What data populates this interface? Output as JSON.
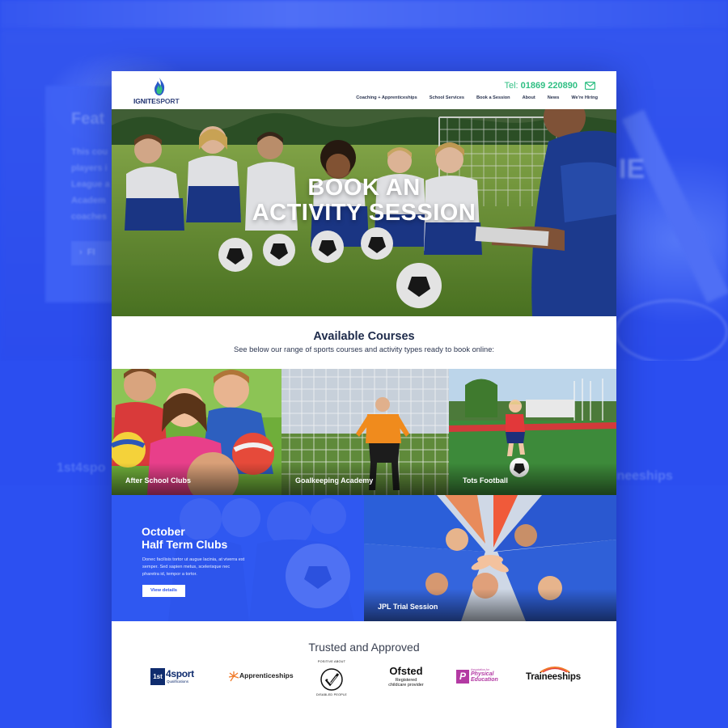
{
  "background": {
    "left_heading": "Feat",
    "left_lines": [
      "This cou",
      "players i",
      "League a",
      "Academ",
      "coaches"
    ],
    "left_button": "FI",
    "side_word": "IE",
    "logo_left": "1st4spo",
    "logo_right": "ineeships"
  },
  "header": {
    "logo_brand": "IGNITE",
    "logo_brand_2": "SPORT",
    "tel_label": "Tel:",
    "tel_number": "01869 220890",
    "nav": [
      "Coaching + Apprenticeships",
      "School Services",
      "Book a Session",
      "About",
      "News",
      "We're Hiring"
    ]
  },
  "hero": {
    "title_line1": "BOOK AN",
    "title_line2": "ACTIVITY SESSION"
  },
  "courses": {
    "heading": "Available Courses",
    "subheading": "See below our range of sports courses and activity types ready to book online:",
    "tiles": [
      "After School Clubs",
      "Goalkeeping Academy",
      "Tots Football",
      "JPL Trial Session"
    ]
  },
  "promo": {
    "title_line1": "October",
    "title_line2": "Half Term Clubs",
    "body": "Donec facilisis tortor ut augue lacinia, at viverra est semper. Sed sapien metus, scelerisque nec pharetra id, tempor a tortor.",
    "button": "View details"
  },
  "trusted": {
    "heading": "Trusted and Approved",
    "logos": {
      "first4sport_num": "1st",
      "first4sport_word": "4sport",
      "first4sport_sub": "Qualifications",
      "apprenticeships": "Apprenticeships",
      "disabled_top": "POSITIVE ABOUT",
      "disabled_bottom": "DISABLED PEOPLE",
      "ofsted": "Ofsted",
      "ofsted_sub1": "Registered",
      "ofsted_sub2": "childcare provider",
      "pe_small": "Association for",
      "pe_line1": "Physical",
      "pe_line2": "Education",
      "traineeships": "Traineeships"
    }
  },
  "colors": {
    "background_blue": "#2a4ef0",
    "accent_green": "#2fbf83",
    "navy": "#1d2a4a",
    "promo_blue": "#2d55f0"
  },
  "icons": [
    "flame-logo-icon",
    "mail-icon"
  ]
}
